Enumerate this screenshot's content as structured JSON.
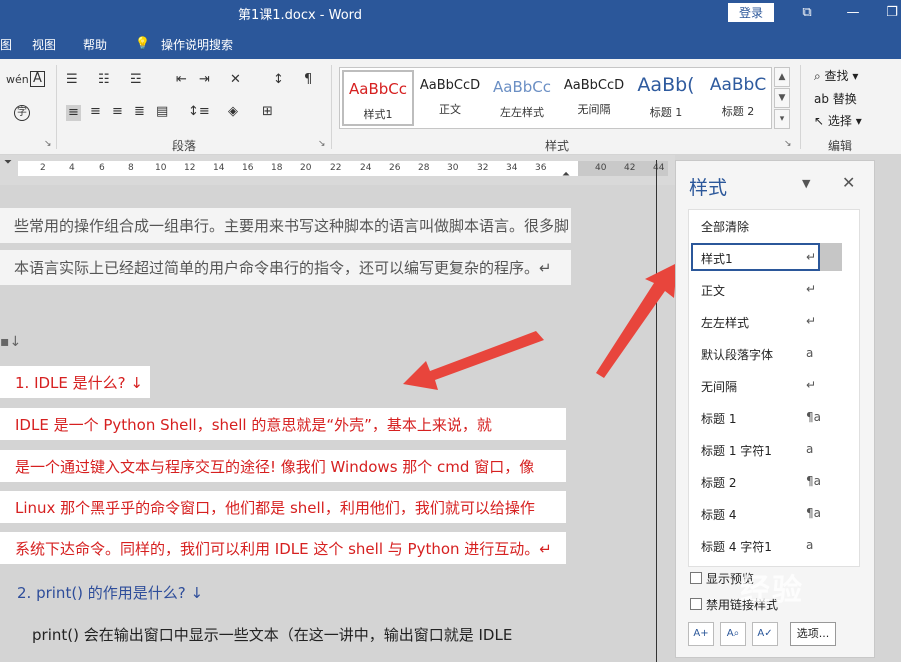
{
  "window": {
    "title": "第1课1.docx  -  Word",
    "login_label": "登录"
  },
  "menu": {
    "items": [
      "图",
      "视图",
      "帮助",
      "操作说明搜索"
    ]
  },
  "ribbon": {
    "groups": {
      "paragraph": "段落",
      "styles": "样式",
      "editing": "编辑"
    },
    "gallery": [
      {
        "sample": "AaBbCc",
        "name": "样式1",
        "color": "#d62020"
      },
      {
        "sample": "AaBbCcD",
        "name": "正文",
        "color": "#222222"
      },
      {
        "sample": "AaBbCc",
        "name": "左左样式",
        "color": "#6b8fc4"
      },
      {
        "sample": "AaBbCcD",
        "name": "无间隔",
        "color": "#222222"
      },
      {
        "sample": "AaBb(",
        "name": "标题 1",
        "color": "#2e5a9e"
      },
      {
        "sample": "AaBbC",
        "name": "标题 2",
        "color": "#2e5a9e"
      }
    ],
    "editing": {
      "find": "查找",
      "replace": "替换",
      "select": "选择"
    }
  },
  "ruler": {
    "ticks": [
      "2",
      "4",
      "6",
      "8",
      "10",
      "12",
      "14",
      "16",
      "18",
      "20",
      "22",
      "24",
      "26",
      "28",
      "30",
      "32",
      "34",
      "36",
      "40",
      "42",
      "44"
    ]
  },
  "document": {
    "gray_lines": [
      "些常用的操作组合成一组串行。主要用来书写这种脚本的语言叫做脚本语言。很多脚",
      "本语言实际上已经超过简单的用户命令串行的指令，还可以编写更复杂的程序。↵"
    ],
    "empty_marker": "↓",
    "heading1": "1. IDLE  是什么? ↓",
    "red_lines": [
      "      IDLE 是一个 Python Shell，shell 的意思就是“外壳”，基本上来说，就",
      "是一个通过键入文本与程序交互的途径! 像我们 Windows 那个 cmd 窗口，像",
      "Linux 那个黑乎乎的命令窗口，他们都是 shell，利用他们，我们就可以给操作",
      "系统下达命令。同样的，我们可以利用 IDLE 这个 shell 与 Python 进行互动。↵"
    ],
    "heading2": "2. print()  的作用是什么? ↓",
    "body_line": "print()  会在输出窗口中显示一些文本（在这一讲中，输出窗口就是 IDLE"
  },
  "styles_pane": {
    "title": "样式",
    "items": [
      {
        "name": "全部清除",
        "mark": ""
      },
      {
        "name": "样式1",
        "mark": "↵"
      },
      {
        "name": "正文",
        "mark": "↵"
      },
      {
        "name": "左左样式",
        "mark": "↵"
      },
      {
        "name": "默认段落字体",
        "mark": "a"
      },
      {
        "name": "无间隔",
        "mark": "↵"
      },
      {
        "name": "标题 1",
        "mark": "¶a"
      },
      {
        "name": "标题 1 字符1",
        "mark": "a"
      },
      {
        "name": "标题 2",
        "mark": "¶a"
      },
      {
        "name": "标题 4",
        "mark": "¶a"
      },
      {
        "name": "标题 4 字符1",
        "mark": "a"
      }
    ],
    "show_preview": "显示预览",
    "disable_linked": "禁用链接样式",
    "options_label": "选项..."
  },
  "watermark": "经验",
  "colors": {
    "accent": "#2b579a",
    "red_text": "#d62020",
    "arrow": "#e8453c"
  }
}
